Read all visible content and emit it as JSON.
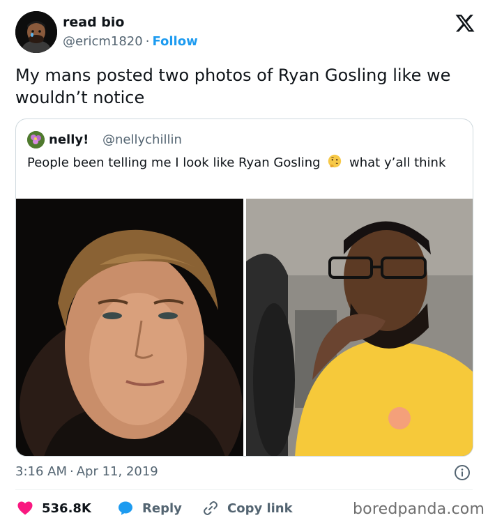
{
  "author": {
    "name": "read bio",
    "handle": "@ericm1820",
    "separator": "·",
    "follow_label": "Follow"
  },
  "tweet": {
    "text": "My mans posted two photos of Ryan Gosling like we wouldn’t notice",
    "time": "3:16 AM",
    "date": "Apr 11, 2019",
    "meta_separator": "·"
  },
  "quoted": {
    "name": "nelly!",
    "handle": "@nellychillin",
    "text_before": "People been telling me I look like Ryan Gosling",
    "emoji": "thinking-face-emoji",
    "text_after": "what y’all think",
    "photos": [
      {
        "description_icon": "photo-left"
      },
      {
        "description_icon": "photo-right"
      }
    ]
  },
  "actions": {
    "like_count": "536.8K",
    "reply_label": "Reply",
    "copy_label": "Copy link"
  },
  "watermark": "boredpanda.com",
  "colors": {
    "accent": "#1d9bf0",
    "like": "#f91880",
    "text": "#0f1419",
    "secondary": "#536471",
    "border": "#cfd9de"
  },
  "icons": [
    "x-logo-icon",
    "info-icon",
    "heart-icon",
    "reply-bubble-icon",
    "link-icon",
    "thinking-face-emoji"
  ]
}
